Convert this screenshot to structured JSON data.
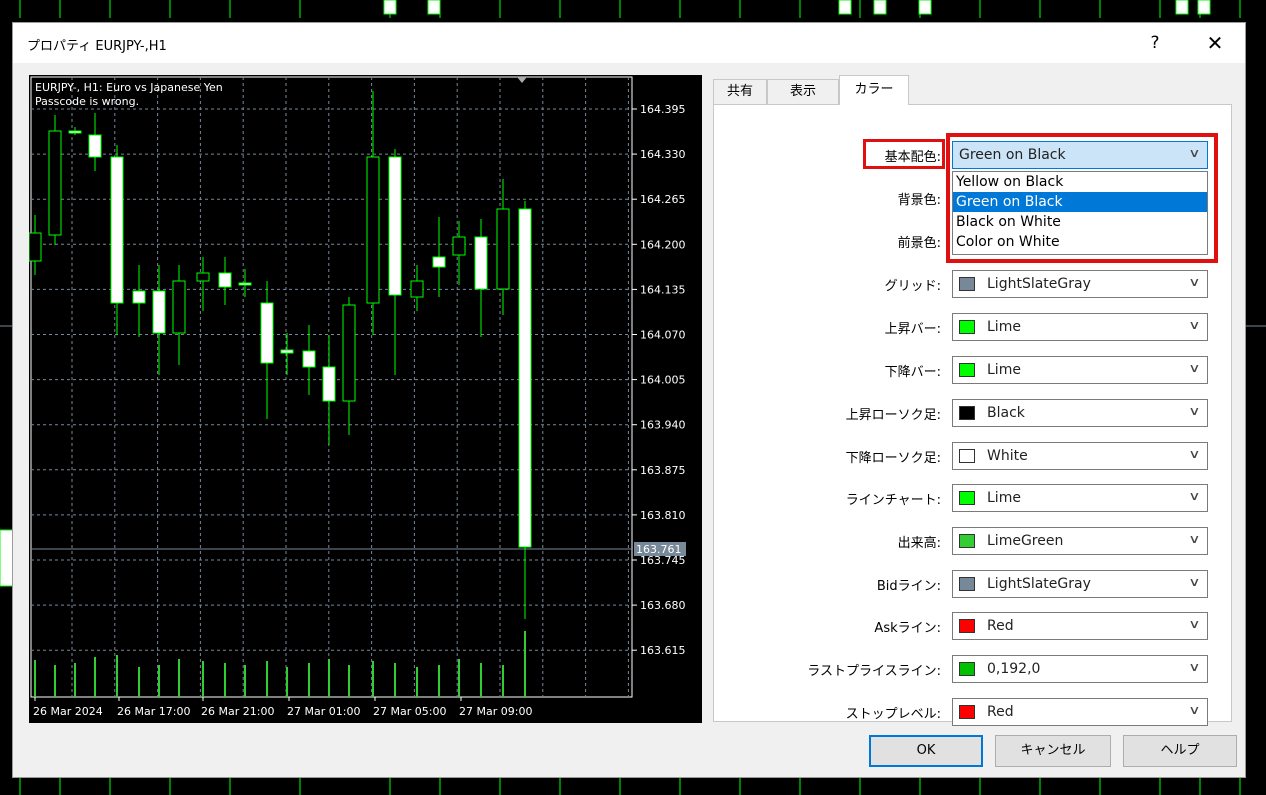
{
  "dialog": {
    "title": "プロパティ EURJPY-,H1",
    "help_label": "?",
    "close_label": "✕"
  },
  "chart": {
    "header_line1": "EURJPY-, H1:  Euro vs Japanese Yen",
    "header_line2": "Passcode is wrong.",
    "price_labels": [
      "164.395",
      "164.330",
      "164.265",
      "164.200",
      "164.135",
      "164.070",
      "164.005",
      "163.940",
      "163.875",
      "163.810",
      "163.745",
      "163.680",
      "163.615"
    ],
    "current_price": "163.761",
    "time_labels": [
      "26 Mar 2024",
      "26 Mar 17:00",
      "26 Mar 21:00",
      "27 Mar 01:00",
      "27 Mar 05:00",
      "27 Mar 09:00"
    ],
    "colors": {
      "background": "#000000",
      "grid": "#778899",
      "bar_up": "#00ff00",
      "candle_bull": "#000000",
      "candle_bear": "#ffffff",
      "volume": "#32cd32",
      "text": "#ffffff"
    }
  },
  "tabs": [
    {
      "label": "共有",
      "active": false
    },
    {
      "label": "表示",
      "active": false
    },
    {
      "label": "カラー",
      "active": true
    }
  ],
  "color_scheme": {
    "label": "基本配色:",
    "value": "Green on Black",
    "options": [
      "Yellow on Black",
      "Green on Black",
      "Black on White",
      "Color on White"
    ],
    "selected_index": 1
  },
  "color_rows": [
    {
      "label": "背景色:",
      "value": "",
      "color": ""
    },
    {
      "label": "前景色:",
      "value": "",
      "color": ""
    },
    {
      "label": "グリッド:",
      "value": "LightSlateGray",
      "color": "#778899"
    },
    {
      "label": "上昇バー:",
      "value": "Lime",
      "color": "#00ff00"
    },
    {
      "label": "下降バー:",
      "value": "Lime",
      "color": "#00ff00"
    },
    {
      "label": "上昇ローソク足:",
      "value": "Black",
      "color": "#000000"
    },
    {
      "label": "下降ローソク足:",
      "value": "White",
      "color": "#ffffff"
    },
    {
      "label": "ラインチャート:",
      "value": "Lime",
      "color": "#00ff00"
    },
    {
      "label": "出来高:",
      "value": "LimeGreen",
      "color": "#32cd32"
    },
    {
      "label": "Bidライン:",
      "value": "LightSlateGray",
      "color": "#778899"
    },
    {
      "label": "Askライン:",
      "value": "Red",
      "color": "#ff0000"
    },
    {
      "label": "ラストプライスライン:",
      "value": "0,192,0",
      "color": "#00c000"
    },
    {
      "label": "ストップレベル:",
      "value": "Red",
      "color": "#ff0000"
    }
  ],
  "buttons": {
    "ok": "OK",
    "cancel": "キャンセル",
    "help": "ヘルプ"
  }
}
